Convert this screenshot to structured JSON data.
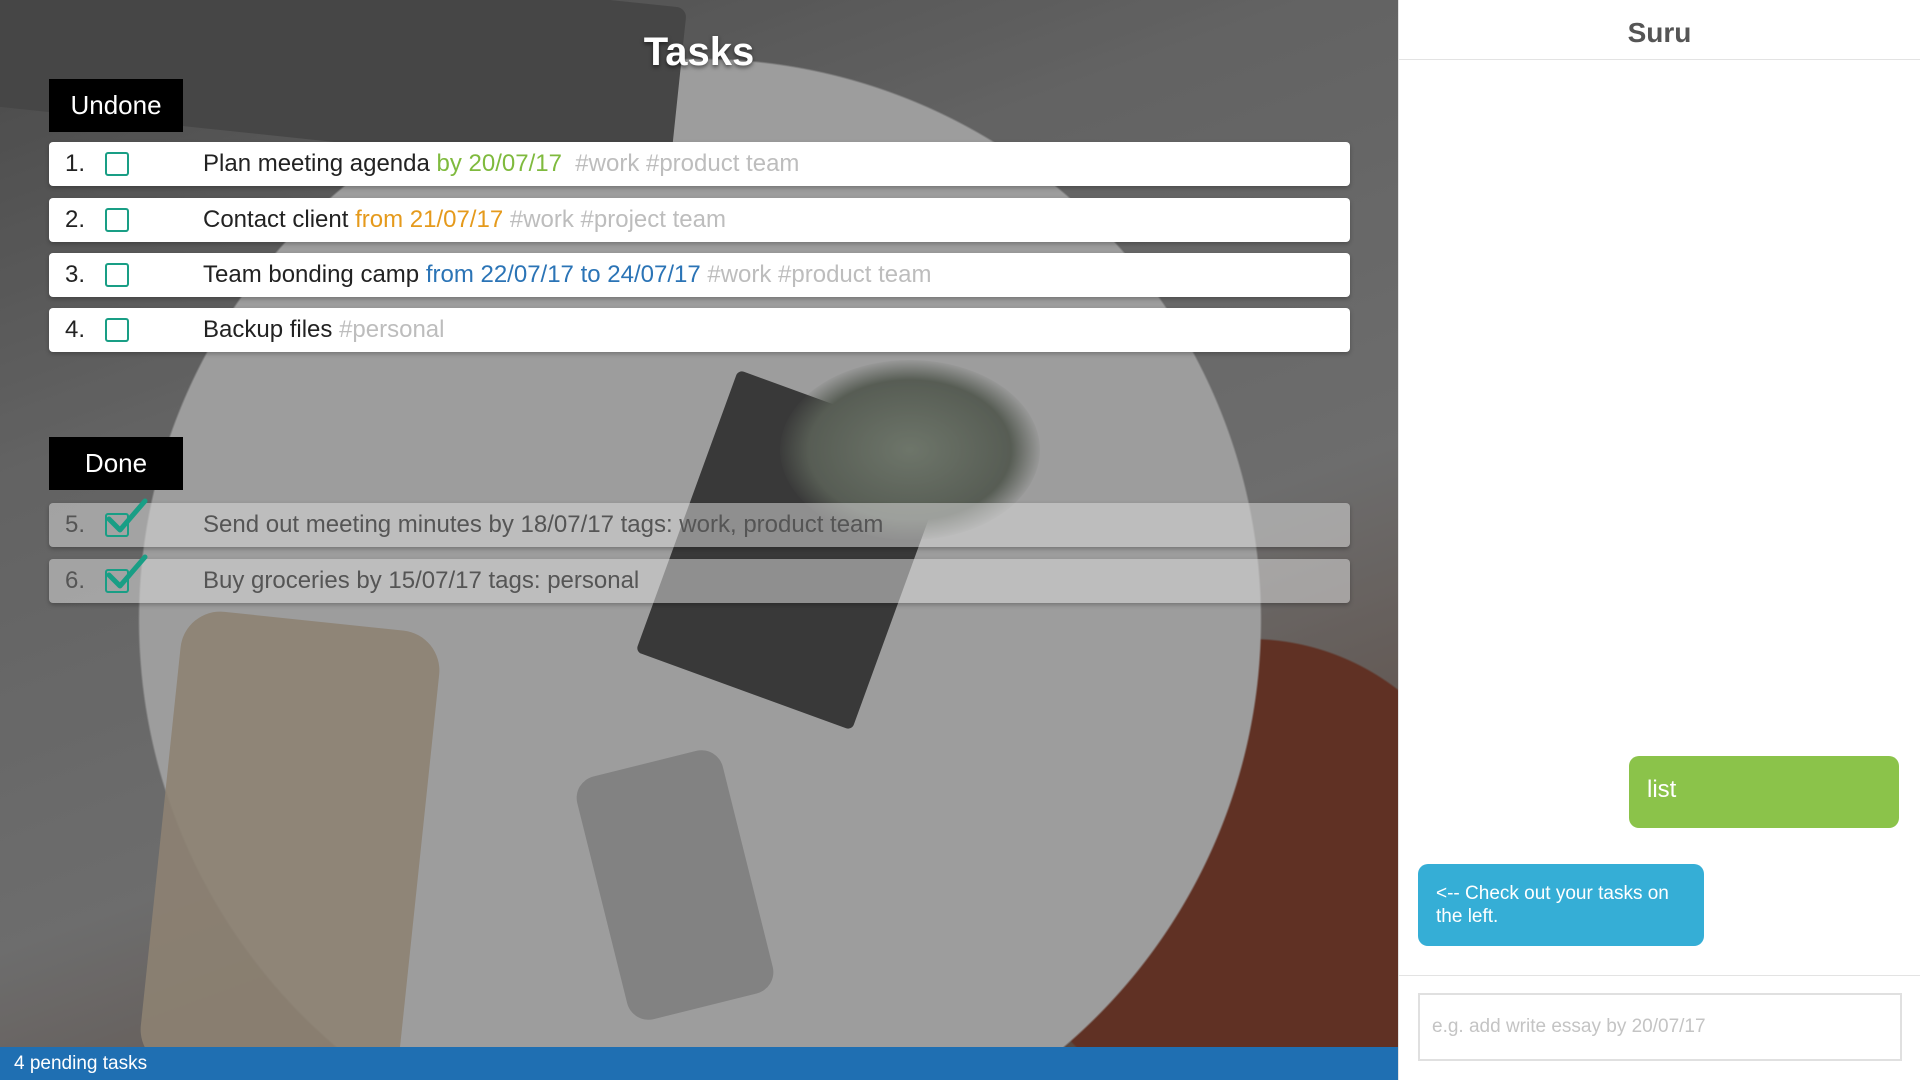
{
  "tasks_pane": {
    "title": "Tasks",
    "undone_label": "Undone",
    "done_label": "Done",
    "undone_tasks": [
      {
        "num": "1.",
        "title": "Plan meeting agenda",
        "date": "by 20/07/17",
        "date_color": "#7fba3e",
        "tags": "#work #product team"
      },
      {
        "num": "2.",
        "title": "Contact client",
        "date": "from 21/07/17",
        "date_color": "#e59a1c",
        "tags": "#work #project team"
      },
      {
        "num": "3.",
        "title": "Team bonding camp",
        "date": "from 22/07/17 to 24/07/17",
        "date_color": "#2b74b6",
        "tags": "#work #product team"
      },
      {
        "num": "4.",
        "title": "Backup files",
        "date": "",
        "date_color": "",
        "tags": "#personal"
      }
    ],
    "done_tasks": [
      {
        "num": "5.",
        "text": "Send out meeting minutes by 18/07/17 tags: work, product team"
      },
      {
        "num": "6.",
        "text": "Buy groceries by 15/07/17 tags: personal"
      }
    ],
    "status": "4 pending tasks"
  },
  "chat": {
    "title": "Suru",
    "messages": [
      {
        "from": "user",
        "text": "list"
      },
      {
        "from": "bot",
        "text": "<-- Check out your tasks on the left."
      }
    ],
    "input_value": "",
    "input_placeholder": "e.g. add write essay by 20/07/17"
  },
  "colors": {
    "status_bar": "#1f6fb2",
    "user_bubble": "#8bc34a",
    "bot_bubble": "#35aed6",
    "checkbox": "#199e85"
  },
  "icons": {
    "unchecked": "empty-checkbox-icon",
    "checked": "checkmark-icon"
  }
}
